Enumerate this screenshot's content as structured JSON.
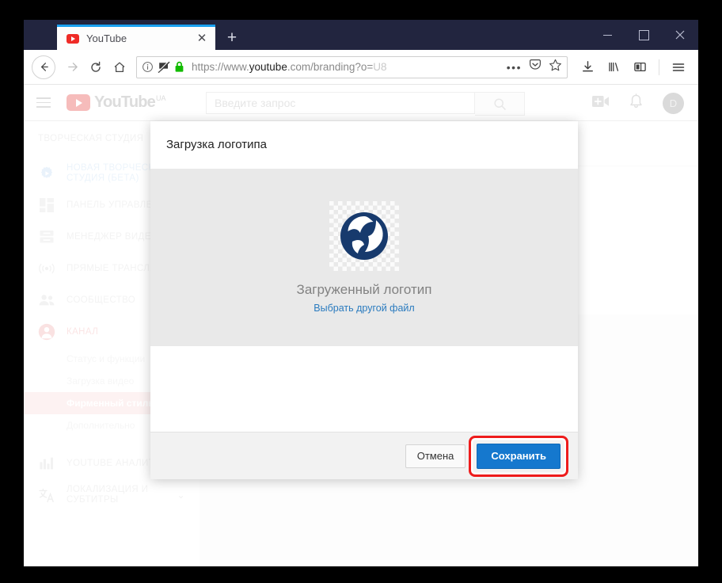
{
  "window": {
    "minimize_label": "—",
    "maximize_label": "□",
    "close_label": "✕"
  },
  "tab": {
    "title": "YouTube",
    "close_label": "✕",
    "new_tab_label": "+"
  },
  "toolbar": {
    "back_icon": "arrow-left-icon",
    "forward_icon": "arrow-right-icon",
    "reload_icon": "reload-icon",
    "home_icon": "home-icon",
    "download_icon": "download-icon",
    "library_icon": "library-icon",
    "sidebar_icon": "sidebar-icon",
    "menu_icon": "hamburger-menu-icon"
  },
  "urlbar": {
    "info_icon": "info-circle-icon",
    "tracking_icon": "tracking-protection-icon",
    "lock_icon": "padlock-icon",
    "scheme": "https://www.",
    "host": "youtube",
    "path": ".com/branding?o=",
    "tail": "U8",
    "page_actions_icon": "ellipsis-icon",
    "pocket_icon": "pocket-icon",
    "bookmark_icon": "star-icon"
  },
  "yt_header": {
    "menu_icon": "hamburger-menu-icon",
    "logo_text": "YouTube",
    "logo_sup": "UA",
    "search_placeholder": "Введите запрос",
    "search_icon": "search-icon",
    "create_video_icon": "video-camera-add-icon",
    "notifications_icon": "bell-icon",
    "avatar_letter": "D"
  },
  "sidebar": {
    "title": "ТВОРЧЕСКАЯ СТУДИЯ",
    "items": [
      {
        "label": "НОВАЯ ТВОРЧЕСКАЯ СТУДИЯ (БЕТА)",
        "icon": "gear-play-icon",
        "state": "beta"
      },
      {
        "label": "ПАНЕЛЬ УПРАВЛЕНИЯ",
        "icon": "dashboard-icon",
        "state": ""
      },
      {
        "label": "МЕНЕДЖЕР ВИДЕО",
        "icon": "video-manager-icon",
        "state": ""
      },
      {
        "label": "ПРЯМЫЕ ТРАНСЛЯЦИИ",
        "icon": "live-broadcast-icon",
        "state": ""
      },
      {
        "label": "СООБЩЕСТВО",
        "icon": "community-people-icon",
        "state": ""
      },
      {
        "label": "КАНАЛ",
        "icon": "channel-person-icon",
        "state": "channel"
      }
    ],
    "sub_items": [
      {
        "label": "Статус и функции",
        "active": false
      },
      {
        "label": "Загрузка видео",
        "active": false
      },
      {
        "label": "Фирменный стиль",
        "active": true
      },
      {
        "label": "Дополнительно",
        "active": false
      }
    ],
    "bottom_items": [
      {
        "label": "YOUTUBE АНАЛИТИКА",
        "icon": "analytics-bars-icon",
        "chevron": "⌄"
      },
      {
        "label": "ЛОКАЛИЗАЦИЯ И СУБТИТРЫ",
        "icon": "translate-icon",
        "chevron": "⌄"
      }
    ]
  },
  "modal": {
    "title": "Загрузка логотипа",
    "logo_alt": "uploaded-logo",
    "drop_label": "Загруженный логотип",
    "choose_other_link": "Выбрать другой файл",
    "cancel_label": "Отмена",
    "save_label": "Сохранить"
  },
  "colors": {
    "titlebar": "#22253f",
    "tab_accent": "#1aa1f1",
    "save_button": "#1578ce",
    "annotation": "#ee1c1c",
    "link": "#2a7bbf",
    "logo_navy": "#173a6d",
    "sidebar_active": "#fbe3e3"
  }
}
